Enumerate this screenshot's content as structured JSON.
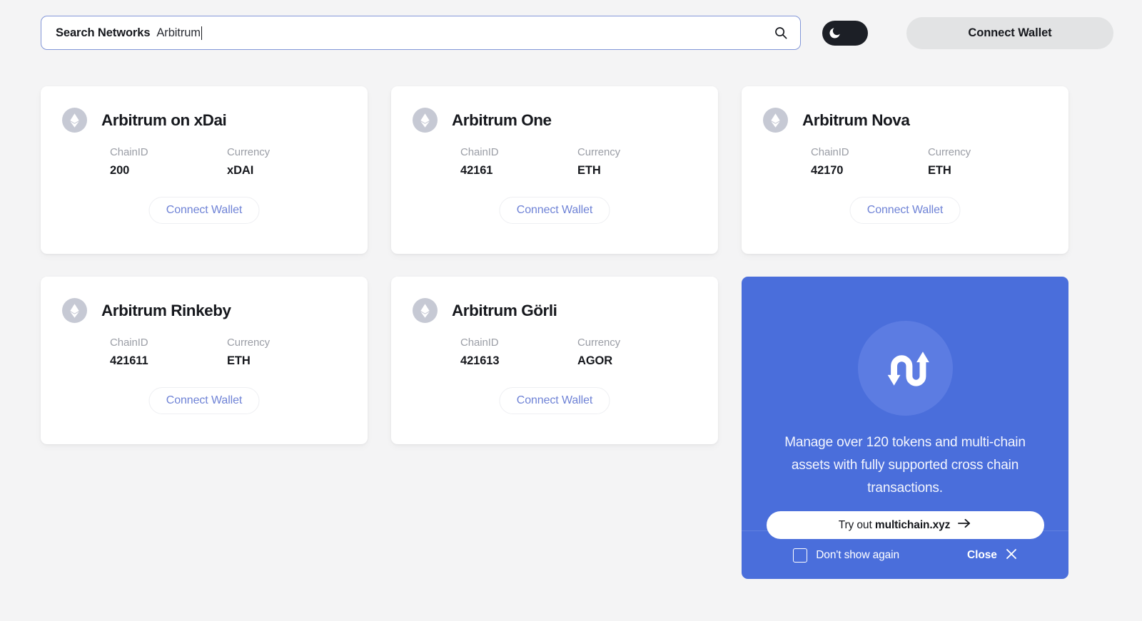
{
  "search": {
    "label": "Search Networks",
    "value": "Arbitrum",
    "placeholder": "Search Networks",
    "icon": "search-icon"
  },
  "theme_toggle": {
    "state": "off",
    "icon": "moon-icon"
  },
  "header": {
    "connect_wallet_label": "Connect Wallet"
  },
  "card_labels": {
    "chain_id": "ChainID",
    "currency": "Currency",
    "connect_wallet": "Connect Wallet"
  },
  "networks": [
    {
      "name": "Arbitrum on xDai",
      "chain_id": "200",
      "currency": "xDAI",
      "icon": "ethereum-icon"
    },
    {
      "name": "Arbitrum One",
      "chain_id": "42161",
      "currency": "ETH",
      "icon": "ethereum-icon"
    },
    {
      "name": "Arbitrum Nova",
      "chain_id": "42170",
      "currency": "ETH",
      "icon": "ethereum-icon"
    },
    {
      "name": "Arbitrum Rinkeby",
      "chain_id": "421611",
      "currency": "ETH",
      "icon": "ethereum-icon"
    },
    {
      "name": "Arbitrum Görli",
      "chain_id": "421613",
      "currency": "AGOR",
      "icon": "ethereum-icon"
    }
  ],
  "promo": {
    "icon": "cross-chain-swap-icon",
    "text": "Manage over 120 tokens and multi-chain assets with fully supported cross chain transactions.",
    "cta_prefix": "Try out",
    "cta_brand": "multichain.xyz",
    "cta_icon": "arrow-right-icon",
    "dont_show_label": "Don't show again",
    "dont_show_checked": false,
    "close_label": "Close",
    "close_icon": "close-x-icon"
  },
  "colors": {
    "page_background": "#f4f4f5",
    "card_background": "#ffffff",
    "promo_background": "#4a6edb",
    "promo_badge": "#5c7ce2",
    "accent_link": "#6f83d6",
    "search_border": "#8296d8",
    "toggle_background": "#1c1f26",
    "muted_text": "#9b9ea6"
  }
}
